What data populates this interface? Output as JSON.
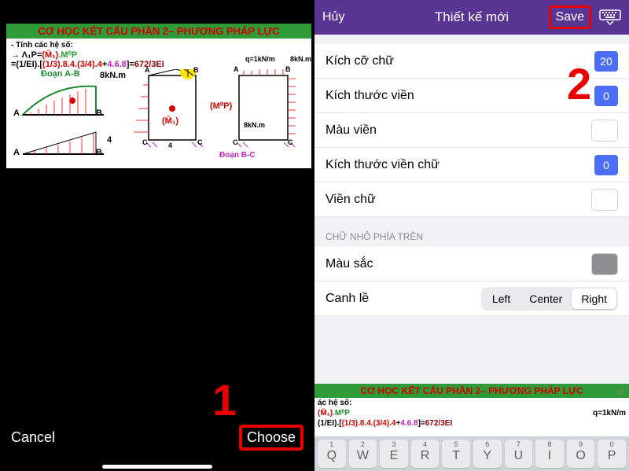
{
  "left": {
    "cancel": "Cancel",
    "choose": "Choose",
    "step_number": "1"
  },
  "image": {
    "title": "CƠ HỌC KẾT CẤU PHẦN 2– PHƯƠNG PHÁP LỰC",
    "line1": "- Tính các hệ số:",
    "line2_lambda": "→ Λ₁P=",
    "line2_m1": "(M̄₁)",
    "line2_mp": ".M⁰P",
    "line3_pre": "=(1/EI).[",
    "line3_a": "(1/3).8.4.(3/4).4",
    "line3_plus": "+",
    "line3_b": "4.6.8",
    "line3_eq": "]=",
    "line3_res": "672/3EI",
    "knm": "8kN.m",
    "legAB": "Đoạn A-B",
    "legBC": "Đoạn B-C",
    "A": "A",
    "B": "B",
    "C": "C",
    "four": "4",
    "M1": "(M̄₁)",
    "Mp": "(M⁰P)",
    "q": "q=1kN/m",
    "kn8": "8kN.m"
  },
  "right": {
    "nav": {
      "cancel": "Hủy",
      "title": "Thiết kế mới",
      "save": "Save"
    },
    "step_number": "2",
    "rows": {
      "fontsize": {
        "label": "Kích cỡ chữ",
        "value": "20"
      },
      "border": {
        "label": "Kích thước viền",
        "value": "0"
      },
      "bcolor": {
        "label": "Màu viền"
      },
      "tborder": {
        "label": "Kích thước viền chữ",
        "value": "0"
      },
      "tbcolor": {
        "label": "Viền chữ"
      }
    },
    "section": "CHỮ NHỎ PHÍA TRÊN",
    "color": "Màu sắc",
    "align_label": "Canh lề",
    "align": {
      "left": "Left",
      "center": "Center",
      "right": "Right"
    }
  },
  "preview": {
    "title": "CƠ HỌC KẾT CẤU PHẦN 2– PHƯƠNG PHÁP LỰC",
    "l1": "ác hệ số:",
    "l2a": "(M̄₁)",
    "l2b": ".M⁰P",
    "l3pre": "(1/EI).[",
    "l3a": "(1/3).8.4.(3/4).4",
    "l3plus": "+",
    "l3b": "4.6.8",
    "l3eq": "]=",
    "l3res": "672/3EI",
    "q": "q=1kN/m"
  },
  "keyboard": [
    {
      "n": "1",
      "c": "Q"
    },
    {
      "n": "2",
      "c": "W"
    },
    {
      "n": "3",
      "c": "E"
    },
    {
      "n": "4",
      "c": "R"
    },
    {
      "n": "5",
      "c": "T"
    },
    {
      "n": "6",
      "c": "Y"
    },
    {
      "n": "7",
      "c": "U"
    },
    {
      "n": "8",
      "c": "I"
    },
    {
      "n": "9",
      "c": "O"
    },
    {
      "n": "0",
      "c": "P"
    }
  ]
}
